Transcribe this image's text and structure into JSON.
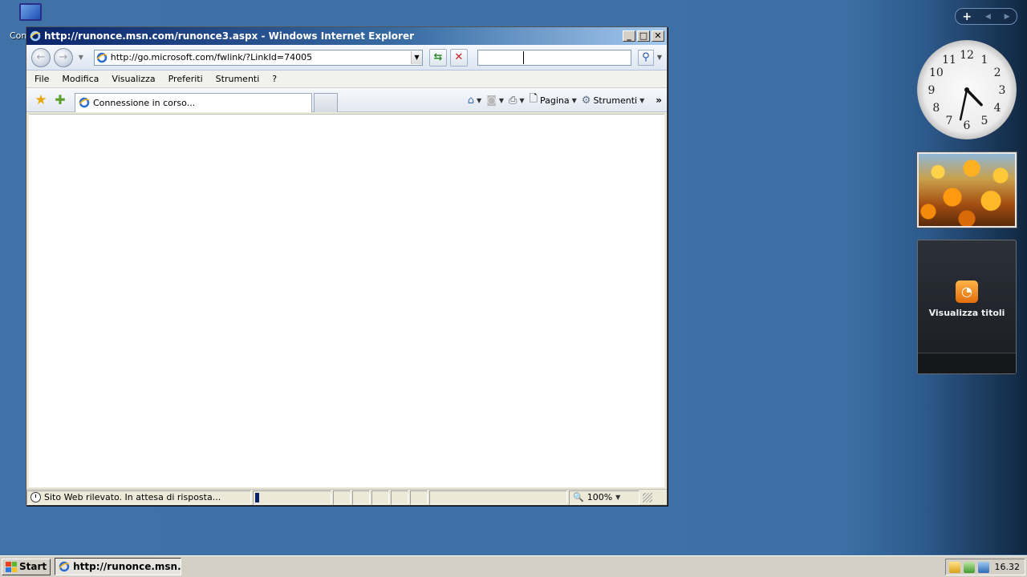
{
  "desktop": {
    "icon_label": "Com"
  },
  "window": {
    "title": "http://runonce.msn.com/runonce3.aspx - Windows Internet Explorer",
    "buttons": {
      "minimize": "_",
      "maximize": "□",
      "close": "✕"
    }
  },
  "address": {
    "url": "http://go.microsoft.com/fwlink/?LinkId=74005",
    "search_value": ""
  },
  "menu": {
    "items": [
      "File",
      "Modifica",
      "Visualizza",
      "Preferiti",
      "Strumenti",
      "?"
    ]
  },
  "commandbar": {
    "tab_label": "Connessione in corso...",
    "page_label": "Pagina",
    "tools_label": "Strumenti"
  },
  "status": {
    "text": "Sito Web rilevato. In attesa di risposta...",
    "zoom": "100%",
    "progress": 0.05
  },
  "gadgets": {
    "feed_label": "Visualizza titoli",
    "clock_numbers": [
      "12",
      "1",
      "2",
      "3",
      "4",
      "5",
      "6",
      "7",
      "8",
      "9",
      "10",
      "11"
    ]
  },
  "taskbar": {
    "start_label": "Start",
    "task_label": "http://runonce.msn.c...",
    "time": "16.32"
  },
  "colors": {
    "desktop": "#3f73a8",
    "titlebar": "#0a246a",
    "rss": "#e36d0a"
  }
}
